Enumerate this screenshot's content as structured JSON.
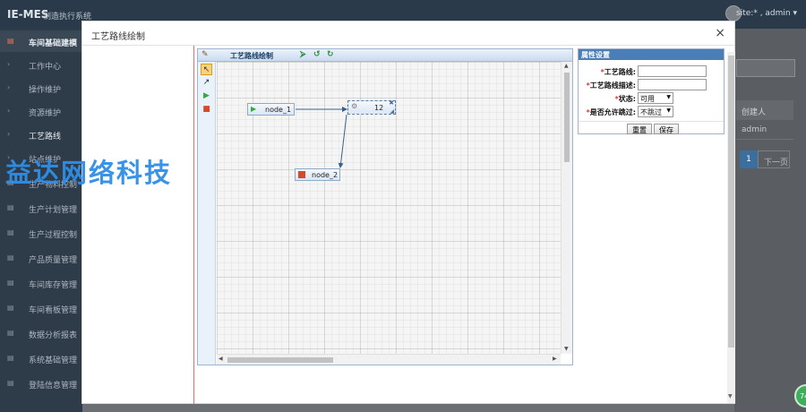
{
  "app": {
    "brand": "IE-MES",
    "brand_sub": "制造执行系统",
    "user": "site:* , admin ▾"
  },
  "sidebar": {
    "items": [
      {
        "icon": "▤",
        "label": "车间基础建模",
        "active": true
      },
      {
        "icon": "›",
        "label": "工作中心"
      },
      {
        "icon": "›",
        "label": "操作维护"
      },
      {
        "icon": "›",
        "label": "资源维护"
      },
      {
        "icon": "›",
        "label": "工艺路线"
      },
      {
        "icon": "›",
        "label": "站点维护"
      },
      {
        "icon": "▤",
        "label": "生产物料控制"
      },
      {
        "icon": "▤",
        "label": "生产计划管理"
      },
      {
        "icon": "▤",
        "label": "生产过程控制"
      },
      {
        "icon": "▤",
        "label": "产品质量管理"
      },
      {
        "icon": "▤",
        "label": "车间库存管理"
      },
      {
        "icon": "▤",
        "label": "车间看板管理"
      },
      {
        "icon": "▤",
        "label": "数据分析报表"
      },
      {
        "icon": "▤",
        "label": "系统基础管理"
      },
      {
        "icon": "▤",
        "label": "登陆信息管理"
      }
    ]
  },
  "background_right": {
    "column_header": "创建人",
    "cell": "admin",
    "page_current": "1",
    "page_next": "下一页",
    "badge": "74"
  },
  "watermark": "益达网络科技",
  "modal": {
    "title": "工艺路线绘制",
    "close": "×"
  },
  "designer": {
    "title": "工艺路线绘制",
    "toolbar_icons": [
      "save-icon",
      "undo-icon",
      "redo-icon"
    ],
    "nodes": {
      "start": "node_1",
      "task": "12",
      "end": "node_2"
    }
  },
  "properties": {
    "title": "属性设置",
    "fields": [
      {
        "label": "工艺路线:",
        "type": "text",
        "value": ""
      },
      {
        "label": "工艺路线描述:",
        "type": "text",
        "value": ""
      },
      {
        "label": "状态:",
        "type": "select",
        "value": "可用"
      },
      {
        "label": "是否允许跳过:",
        "type": "select",
        "value": "不跳过"
      }
    ],
    "reset_label": "重置",
    "save_label": "保存"
  }
}
